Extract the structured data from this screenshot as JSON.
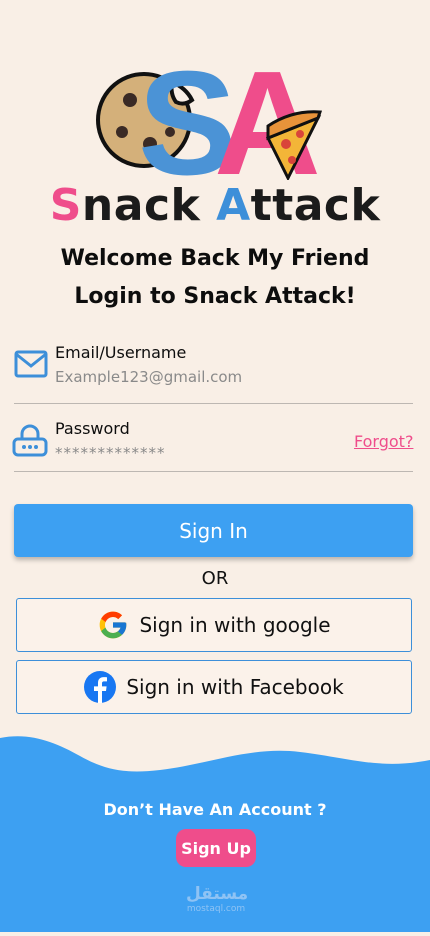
{
  "brand": {
    "s": "S",
    "nack": "nack ",
    "a": "A",
    "ttack": "ttack"
  },
  "welcome": {
    "line1": "Welcome Back My Friend",
    "line2": "Login to Snack Attack!"
  },
  "email": {
    "label": "Email/Username",
    "value": "Example123@gmail.com",
    "icon": "envelope-icon"
  },
  "password": {
    "label": "Password",
    "value": "*************",
    "icon": "lock-icon",
    "forgot": "Forgot?"
  },
  "signin": {
    "label": "Sign In"
  },
  "or": "OR",
  "google": {
    "label": "Sign in with google",
    "icon": "google-icon"
  },
  "facebook": {
    "label": "Sign in with Facebook",
    "icon": "facebook-icon"
  },
  "footer": {
    "question": "Don’t Have An Account ?",
    "signup": "Sign Up"
  },
  "watermark": {
    "arabic": "مستقل",
    "latin": "mostaql.com"
  },
  "colors": {
    "background": "#f9efe6",
    "primary": "#3da0f2",
    "accent": "#ef4d8b"
  }
}
